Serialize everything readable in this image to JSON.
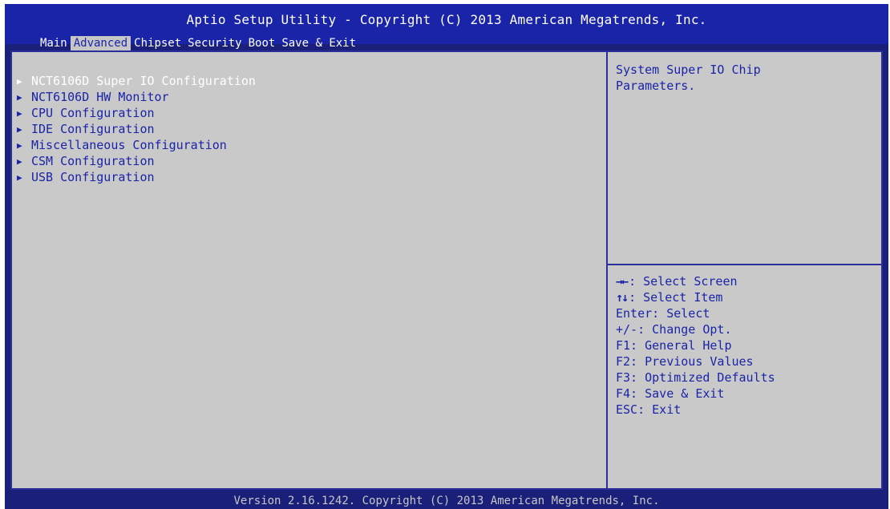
{
  "title": "Aptio Setup Utility - Copyright (C) 2013 American Megatrends, Inc.",
  "tabs": [
    {
      "label": "Main",
      "active": false
    },
    {
      "label": "Advanced",
      "active": true
    },
    {
      "label": "Chipset",
      "active": false
    },
    {
      "label": "Security",
      "active": false
    },
    {
      "label": "Boot",
      "active": false
    },
    {
      "label": "Save & Exit",
      "active": false
    }
  ],
  "menu": {
    "items": [
      {
        "label": "NCT6106D Super IO Configuration",
        "selected": true
      },
      {
        "label": "NCT6106D HW Monitor",
        "selected": false
      },
      {
        "label": "CPU Configuration",
        "selected": false
      },
      {
        "label": "IDE Configuration",
        "selected": false
      },
      {
        "label": "Miscellaneous Configuration",
        "selected": false
      },
      {
        "label": "CSM Configuration",
        "selected": false
      },
      {
        "label": "USB Configuration",
        "selected": false
      }
    ]
  },
  "help": {
    "line1": "System Super IO Chip",
    "line2": "Parameters."
  },
  "keys": [
    {
      "icon": "left-right-arrows-icon",
      "glyph": "→←",
      "text": ": Select Screen"
    },
    {
      "icon": "up-down-arrows-icon",
      "glyph": "↑↓",
      "text": ": Select Item"
    },
    {
      "icon": "",
      "glyph": "",
      "text": "Enter: Select"
    },
    {
      "icon": "",
      "glyph": "",
      "text": "+/-: Change Opt."
    },
    {
      "icon": "",
      "glyph": "",
      "text": "F1: General Help"
    },
    {
      "icon": "",
      "glyph": "",
      "text": "F2: Previous Values"
    },
    {
      "icon": "",
      "glyph": "",
      "text": "F3: Optimized Defaults"
    },
    {
      "icon": "",
      "glyph": "",
      "text": "F4: Save & Exit"
    },
    {
      "icon": "",
      "glyph": "",
      "text": "ESC: Exit"
    }
  ],
  "footer": "Version 2.16.1242. Copyright (C) 2013 American Megatrends, Inc.",
  "colors": {
    "background": "#1a1f7a",
    "title_bar": "#1a24a8",
    "panel": "#c9c9c9",
    "text_blue": "#1a24a8",
    "highlight_text": "#ffffff"
  }
}
